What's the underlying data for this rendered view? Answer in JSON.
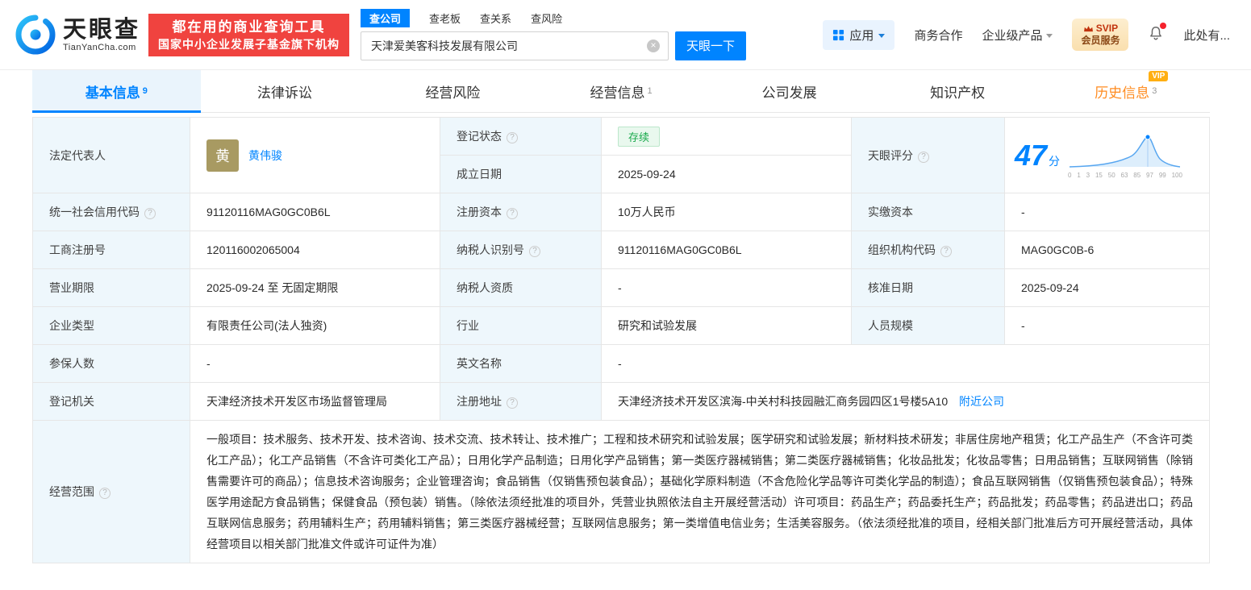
{
  "header": {
    "brand_cn": "天眼查",
    "brand_en": "TianYanCha.com",
    "promo_line1": "都在用的商业查询工具",
    "promo_line2": "国家中小企业发展子基金旗下机构",
    "search_tabs": [
      {
        "label": "查公司"
      },
      {
        "label": "查老板"
      },
      {
        "label": "查关系"
      },
      {
        "label": "查风险"
      }
    ],
    "search_value": "天津爱美客科技发展有限公司",
    "search_button": "天眼一下",
    "app_label": "应用",
    "biz_label": "商务合作",
    "enterprise_label": "企业级产品",
    "svip_line1": "SVIP",
    "svip_line2": "会员服务",
    "user_label": "此处有..."
  },
  "nav_tabs": [
    {
      "label": "基本信息",
      "count": "9"
    },
    {
      "label": "法律诉讼",
      "count": ""
    },
    {
      "label": "经营风险",
      "count": ""
    },
    {
      "label": "经营信息",
      "count": "1"
    },
    {
      "label": "公司发展",
      "count": ""
    },
    {
      "label": "知识产权",
      "count": ""
    },
    {
      "label": "历史信息",
      "count": "3",
      "vip": "VIP"
    }
  ],
  "info": {
    "legal_rep": {
      "label": "法定代表人",
      "avatar": "黄",
      "name": "黄伟骏"
    },
    "reg_status": {
      "label": "登记状态",
      "value": "存续"
    },
    "establish_date": {
      "label": "成立日期",
      "value": "2025-09-24"
    },
    "score": {
      "label": "天眼评分",
      "value": "47",
      "unit": "分",
      "ticks": [
        "0",
        "1",
        "3",
        "15",
        "50",
        "63",
        "85",
        "97",
        "99",
        "100"
      ]
    },
    "credit_code": {
      "label": "统一社会信用代码",
      "value": "91120116MAG0GC0B6L"
    },
    "reg_capital": {
      "label": "注册资本",
      "value": "10万人民币"
    },
    "paid_capital": {
      "label": "实缴资本",
      "value": "-"
    },
    "reg_number": {
      "label": "工商注册号",
      "value": "120116002065004"
    },
    "taxpayer_id": {
      "label": "纳税人识别号",
      "value": "91120116MAG0GC0B6L"
    },
    "org_code": {
      "label": "组织机构代码",
      "value": "MAG0GC0B-6"
    },
    "business_term": {
      "label": "营业期限",
      "value": "2025-09-24 至 无固定期限"
    },
    "taxpayer_quality": {
      "label": "纳税人资质",
      "value": "-"
    },
    "approval_date": {
      "label": "核准日期",
      "value": "2025-09-24"
    },
    "company_type": {
      "label": "企业类型",
      "value": "有限责任公司(法人独资)"
    },
    "industry": {
      "label": "行业",
      "value": "研究和试验发展"
    },
    "staff_size": {
      "label": "人员规模",
      "value": "-"
    },
    "insured_count": {
      "label": "参保人数",
      "value": "-"
    },
    "english_name": {
      "label": "英文名称",
      "value": "-"
    },
    "reg_authority": {
      "label": "登记机关",
      "value": "天津经济技术开发区市场监督管理局"
    },
    "reg_address": {
      "label": "注册地址",
      "value": "天津经济技术开发区滨海-中关村科技园融汇商务园四区1号楼5A10",
      "nearby_link": "附近公司"
    },
    "business_scope": {
      "label": "经营范围",
      "value": "一般项目：技术服务、技术开发、技术咨询、技术交流、技术转让、技术推广；工程和技术研究和试验发展；医学研究和试验发展；新材料技术研发；非居住房地产租赁；化工产品生产（不含许可类化工产品）；化工产品销售（不含许可类化工产品）；日用化学产品制造；日用化学产品销售；第一类医疗器械销售；第二类医疗器械销售；化妆品批发；化妆品零售；日用品销售；互联网销售（除销售需要许可的商品）；信息技术咨询服务；企业管理咨询；食品销售（仅销售预包装食品）；基础化学原料制造（不含危险化学品等许可类化学品的制造）；食品互联网销售（仅销售预包装食品）；特殊医学用途配方食品销售；保健食品（预包装）销售。（除依法须经批准的项目外，凭营业执照依法自主开展经营活动）许可项目：药品生产；药品委托生产；药品批发；药品零售；药品进出口；药品互联网信息服务；药用辅料生产；药用辅料销售；第三类医疗器械经营；互联网信息服务；第一类增值电信业务；生活美容服务。（依法须经批准的项目，经相关部门批准后方可开展经营活动，具体经营项目以相关部门批准文件或许可证件为准）"
    }
  }
}
